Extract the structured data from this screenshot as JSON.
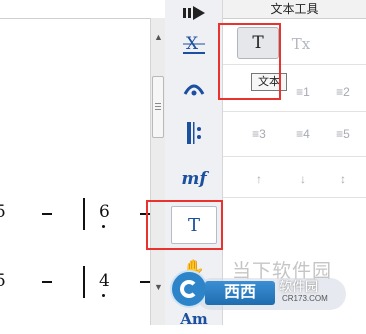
{
  "panel": {
    "title": "文本工具",
    "text_button_label": "T",
    "clear_format_label": "Tx",
    "tooltip": "文本",
    "tool_rows": [
      [
        "≡1",
        "≡2"
      ],
      [
        "≡3",
        "≡4",
        "≡5"
      ],
      [
        "↑",
        "↓",
        "↕"
      ]
    ]
  },
  "palette": {
    "items": [
      {
        "name": "arrow-right-icon",
        "glyph": "➡"
      },
      {
        "name": "x-strike-icon",
        "glyph": "X̶"
      },
      {
        "name": "fermata-icon",
        "glyph": "𝄐"
      },
      {
        "name": "repeat-sign-icon",
        "glyph": "‖:"
      },
      {
        "name": "dynamics-mf",
        "glyph": "mf"
      },
      {
        "name": "text-tool",
        "glyph": "T"
      },
      {
        "name": "hand-icon",
        "glyph": "✋"
      },
      {
        "name": "chord-am",
        "glyph": "Am"
      }
    ]
  },
  "score": {
    "row1": {
      "note_a": "5",
      "dash": "–",
      "note_b": "6"
    },
    "row2": {
      "note_a": "5",
      "dash": "–",
      "note_b": "4"
    }
  },
  "watermark": {
    "site_text": "当下软件园",
    "brand": "西西",
    "name": "软件园",
    "url": "CR173.COM"
  },
  "colors": {
    "highlight": "#e8332f",
    "palette_icon": "#1b4fa0"
  }
}
